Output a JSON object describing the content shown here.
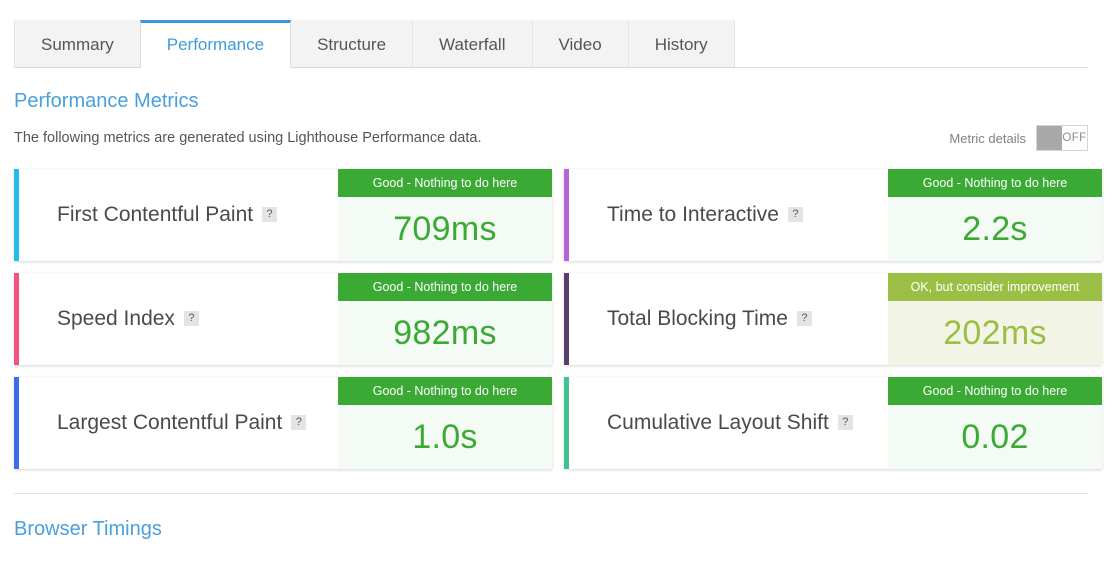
{
  "tabs": [
    {
      "label": "Summary",
      "active": false
    },
    {
      "label": "Performance",
      "active": true
    },
    {
      "label": "Structure",
      "active": false
    },
    {
      "label": "Waterfall",
      "active": false
    },
    {
      "label": "Video",
      "active": false
    },
    {
      "label": "History",
      "active": false
    }
  ],
  "section": {
    "title": "Performance Metrics",
    "subtitle": "The following metrics are generated using Lighthouse Performance data."
  },
  "toggle": {
    "label": "Metric details",
    "state": "OFF"
  },
  "help_glyph": "?",
  "status_colors": {
    "good_badge": "#3aaa35",
    "good_value": "#3aaa35",
    "good_bg": "#f4fbf4",
    "ok_badge": "#9abf44",
    "ok_value": "#9abf44",
    "ok_bg": "#f2f5e6"
  },
  "metrics": [
    {
      "name": "First Contentful Paint",
      "value": "709ms",
      "status_label": "Good - Nothing to do here",
      "status": "good",
      "accent": "#22bdef"
    },
    {
      "name": "Time to Interactive",
      "value": "2.2s",
      "status_label": "Good - Nothing to do here",
      "status": "good",
      "accent": "#b565db"
    },
    {
      "name": "Speed Index",
      "value": "982ms",
      "status_label": "Good - Nothing to do here",
      "status": "good",
      "accent": "#f5527e"
    },
    {
      "name": "Total Blocking Time",
      "value": "202ms",
      "status_label": "OK, but consider improvement",
      "status": "ok",
      "accent": "#5b3f6b"
    },
    {
      "name": "Largest Contentful Paint",
      "value": "1.0s",
      "status_label": "Good - Nothing to do here",
      "status": "good",
      "accent": "#3b6fe8"
    },
    {
      "name": "Cumulative Layout Shift",
      "value": "0.02",
      "status_label": "Good - Nothing to do here",
      "status": "good",
      "accent": "#3fc38e"
    }
  ],
  "footer": {
    "title": "Browser Timings"
  }
}
